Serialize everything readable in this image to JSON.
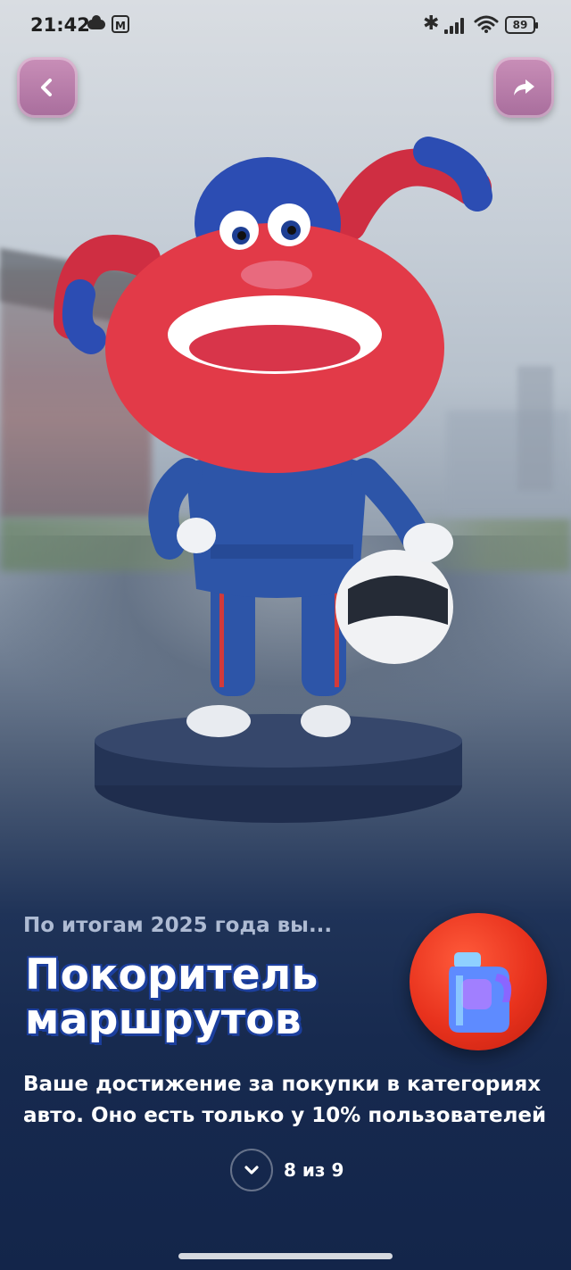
{
  "status_bar": {
    "time": "21:42",
    "battery": "89"
  },
  "top_bar": {
    "back_icon": "chevron-left-icon",
    "share_icon": "share-arrow-icon",
    "button_color": "#b47aa8"
  },
  "content": {
    "subtitle": "По итогам 2025 года вы...",
    "title": "Покоритель маршрутов",
    "description": "Ваше достижение за покупки в категориях авто. Оно есть только у 10% пользователей",
    "badge_icon": "canister-icon"
  },
  "pager": {
    "label": "8 из 9",
    "current": 8,
    "total": 9
  },
  "colors": {
    "background_bottom": "#13254a",
    "badge_red": "#e8321d",
    "title_outline": "#1c3f9e"
  }
}
